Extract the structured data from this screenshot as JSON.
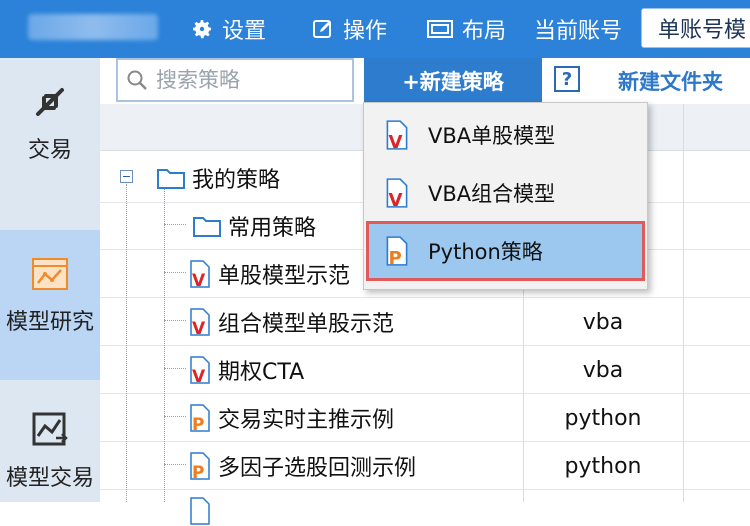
{
  "header": {
    "settings_label": "设置",
    "operate_label": "操作",
    "layout_label": "布局",
    "current_account_label": "当前账号",
    "account_mode_label": "单账号模"
  },
  "sidebar": {
    "items": [
      {
        "label": "交易",
        "icon": "trade-arrows-icon"
      },
      {
        "label": "模型研究",
        "icon": "model-research-icon"
      },
      {
        "label": "模型交易",
        "icon": "model-trade-icon"
      }
    ]
  },
  "toolbar": {
    "search_placeholder": "搜索策略",
    "new_strategy_label": "+新建策略",
    "help_label": "?",
    "new_folder_label": "新建文件夹"
  },
  "dropdown": {
    "items": [
      {
        "label": "VBA单股模型",
        "icon": "vba-file-icon"
      },
      {
        "label": "VBA组合模型",
        "icon": "vba-file-icon"
      },
      {
        "label": "Python策略",
        "icon": "python-file-icon",
        "highlighted": true
      }
    ]
  },
  "tree": {
    "root": "我的策略",
    "folder": "常用策略",
    "rows": [
      {
        "name": "单股模型示范",
        "type": "",
        "kind": "vba"
      },
      {
        "name": "组合模型单股示范",
        "type": "vba",
        "kind": "vba"
      },
      {
        "name": "期权CTA",
        "type": "vba",
        "kind": "vba"
      },
      {
        "name": "交易实时主推示例",
        "type": "python",
        "kind": "python"
      },
      {
        "name": "多因子选股回测示例",
        "type": "python",
        "kind": "python"
      }
    ]
  },
  "colors": {
    "accent": "#2c82d8",
    "vba_red": "#d9262b",
    "python_orange": "#f07c1c",
    "highlight_border": "#e05a5a"
  }
}
